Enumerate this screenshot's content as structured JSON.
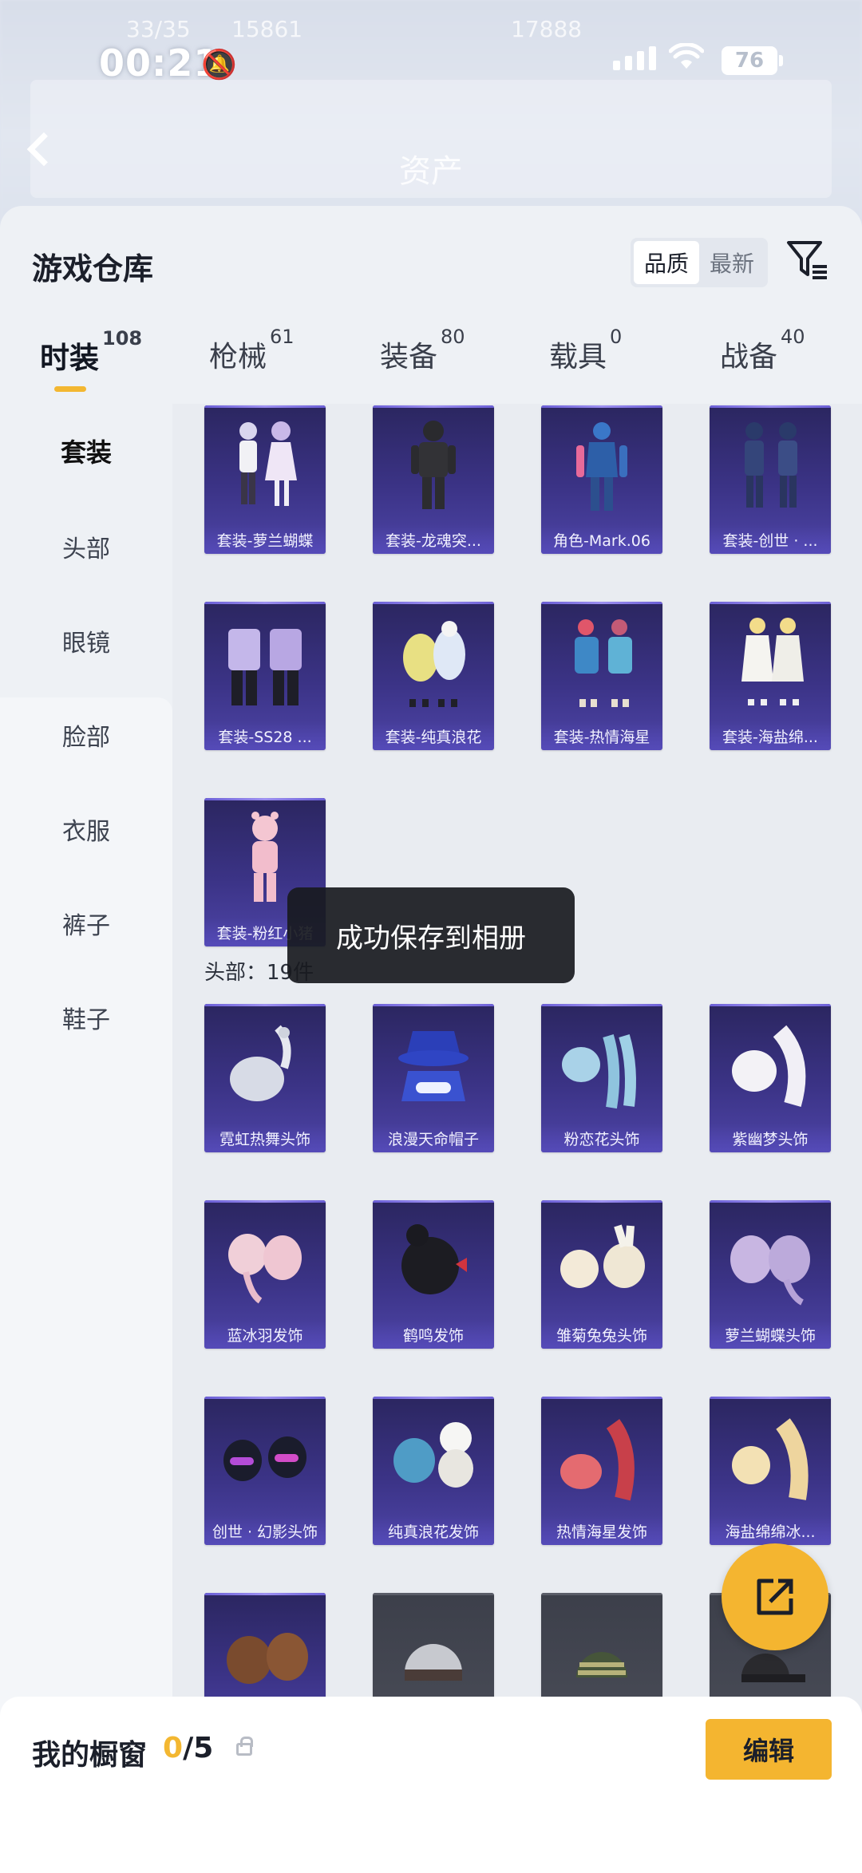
{
  "status": {
    "time": "00:21",
    "battery": "76",
    "faint_left": "33/35",
    "faint_mid": "15861",
    "faint_right": "17888"
  },
  "header": {
    "title": "资产"
  },
  "sheet": {
    "title": "游戏仓库",
    "sort_options": [
      {
        "label": "品质",
        "active": true
      },
      {
        "label": "最新",
        "active": false
      }
    ]
  },
  "tabs": [
    {
      "label": "时装",
      "count": "108",
      "active": true
    },
    {
      "label": "枪械",
      "count": "61"
    },
    {
      "label": "装备",
      "count": "80"
    },
    {
      "label": "载具",
      "count": "0"
    },
    {
      "label": "战备",
      "count": "40"
    }
  ],
  "categories": [
    {
      "label": "套装",
      "active": true
    },
    {
      "label": "头部"
    },
    {
      "label": "眼镜"
    },
    {
      "label": "脸部"
    },
    {
      "label": "衣服"
    },
    {
      "label": "裤子"
    },
    {
      "label": "鞋子"
    }
  ],
  "suits": [
    "套装-萝兰蝴蝶",
    "套装-龙魂突...",
    "角色-Mark.06",
    "套装-创世 · ...",
    "套装-SS28 ...",
    "套装-纯真浪花",
    "套装-热情海星",
    "套装-海盐绵...",
    "套装-粉红小猪"
  ],
  "head_section_label": "头部：19件",
  "heads": [
    "霓虹热舞头饰",
    "浪漫天命帽子",
    "粉恋花头饰",
    "紫幽梦头饰",
    "蓝冰羽发饰",
    "鹤鸣发饰",
    "雏菊兔兔头饰",
    "萝兰蝴蝶头饰",
    "创世 · 幻影头饰",
    "纯真浪花发饰",
    "热情海星发饰",
    "海盐绵绵冰..."
  ],
  "toast": "成功保存到相册",
  "showcase": {
    "title": "我的橱窗",
    "count_current": "0",
    "count_total": "/5",
    "edit_label": "编辑"
  },
  "colors": {
    "accent": "#f3b731",
    "card_purple": "#3b3386",
    "toast_bg": "#181a20"
  }
}
